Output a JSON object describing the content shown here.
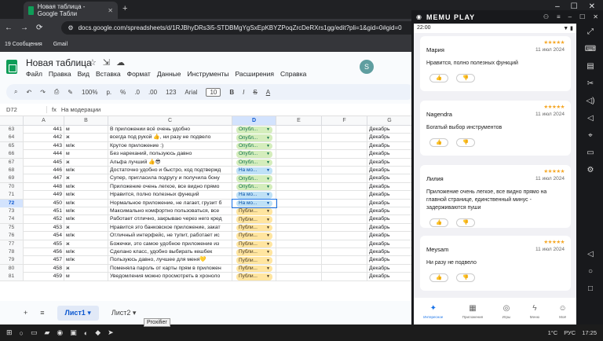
{
  "browser": {
    "tab_title": "Новая таблица - Google Табли",
    "url": "docs.google.com/spreadsheets/d/1RJBhyDRs3i5-STDBMgYgSxEpKBYZPoqZrcDeRXrs1gg/edit?pli=1&gid=0#gid=0",
    "bookmarks": [
      "19 Сообщения",
      "Gmail"
    ]
  },
  "sheets": {
    "title": "Новая таблица",
    "menu": [
      "Файл",
      "Правка",
      "Вид",
      "Вставка",
      "Формат",
      "Данные",
      "Инструменты",
      "Расширения",
      "Справка"
    ],
    "avatar": "S",
    "toolbar": {
      "zoom": "100%",
      "currency": "р.",
      "percent": "%",
      "dec": ".0",
      "dec2": ".00",
      "format123": "123",
      "font": "Arial",
      "font_size": "10"
    },
    "cell_ref": "D72",
    "formula": "На модерации",
    "columns": [
      "A",
      "B",
      "C",
      "D",
      "E",
      "F",
      "G"
    ],
    "rows": [
      {
        "n": "63",
        "a": "441",
        "b": "м",
        "c": "В приложении всё очень удобно",
        "d": "Опубл...",
        "s": "green",
        "g": "Декабрь"
      },
      {
        "n": "64",
        "a": "442",
        "b": "ж",
        "c": "всегда под рукой 👍, ни разу не подвело",
        "d": "Опубл...",
        "s": "green",
        "g": "Декабрь"
      },
      {
        "n": "65",
        "a": "443",
        "b": "м/ж",
        "c": "Крутое приложение :)",
        "d": "Опубл...",
        "s": "green",
        "g": "Декабрь"
      },
      {
        "n": "66",
        "a": "444",
        "b": "м",
        "c": " Без нареканий, пользуюсь давно",
        "d": "Опубл...",
        "s": "green",
        "g": "Декабрь"
      },
      {
        "n": "67",
        "a": "445",
        "b": "ж",
        "c": "Альфа лучший 👍😎",
        "d": "Опубл...",
        "s": "green",
        "g": "Декабрь"
      },
      {
        "n": "68",
        "a": "446",
        "b": "м/ж",
        "c": "Достаточно удобно и быстро, код подтвержд",
        "d": "На мо...",
        "s": "blue",
        "g": "Декабрь"
      },
      {
        "n": "69",
        "a": "447",
        "b": "ж",
        "c": "Супер, пригласила подругу и получила бону",
        "d": "Опубл...",
        "s": "green",
        "g": "Декабрь"
      },
      {
        "n": "70",
        "a": "448",
        "b": "м/ж",
        "c": "Приложение очень легкое, все видно прямо",
        "d": "Опубл...",
        "s": "green",
        "g": "Декабрь"
      },
      {
        "n": "71",
        "a": "449",
        "b": "м/ж",
        "c": "Нравится, полно полезных функций",
        "d": "На мо...",
        "s": "blue",
        "g": "Декабрь"
      },
      {
        "n": "72",
        "a": "450",
        "b": "м/ж",
        "c": "Нормальное приложение, не лагает, грузит б",
        "d": "На мо...",
        "s": "blue",
        "g": "Декабрь"
      },
      {
        "n": "73",
        "a": "451",
        "b": "м/ж",
        "c": "Максимально комфортно пользоваться, все",
        "d": "Публи...",
        "s": "orange",
        "g": "Декабрь"
      },
      {
        "n": "74",
        "a": "452",
        "b": "м/ж",
        "c": "Работает отлично, закрываю через него кред",
        "d": "Публи...",
        "s": "orange",
        "g": "Декабрь"
      },
      {
        "n": "75",
        "a": "453",
        "b": "ж",
        "c": "Нравится это банковское приложение, закат",
        "d": "Публи...",
        "s": "orange",
        "g": "Декабрь"
      },
      {
        "n": "76",
        "a": "454",
        "b": "м/ж",
        "c": "Отличный интерфейс, не тупит, работает ис",
        "d": "Публи...",
        "s": "orange",
        "g": "Декабрь"
      },
      {
        "n": "77",
        "a": "455",
        "b": "ж",
        "c": "Божечки, это самое удобное приложение из",
        "d": "Публи...",
        "s": "orange",
        "g": "Декабрь"
      },
      {
        "n": "78",
        "a": "456",
        "b": "м/ж",
        "c": "Сделано класс, удобно выбирать кешбек",
        "d": "Публи...",
        "s": "orange",
        "g": "Декабрь"
      },
      {
        "n": "79",
        "a": "457",
        "b": "м/ж",
        "c": "Пользуюсь давно, лучшее для меня💛",
        "d": "Публи...",
        "s": "orange",
        "g": "Декабрь"
      },
      {
        "n": "80",
        "a": "458",
        "b": "ж",
        "c": "Поменяла пароль от карты прям в приложен",
        "d": "Публи...",
        "s": "orange",
        "g": "Декабрь"
      },
      {
        "n": "81",
        "a": "459",
        "b": "м",
        "c": "Уведомления можно просмотреть в хроноло",
        "d": "Публи...",
        "s": "orange",
        "g": "Декабрь"
      }
    ],
    "sheet_tabs": [
      "Лист1",
      "Лист2"
    ],
    "tooltip": "Proxifier"
  },
  "memu": {
    "title": "MEMU PLAY",
    "time": "22:00",
    "reviews": [
      {
        "name": "Мария",
        "date": "11 июл 2024",
        "text": "Нравится, полно полезных функций"
      },
      {
        "name": "Nagendra",
        "date": "11 июл 2024",
        "text": "Богатый выбор инструментов"
      },
      {
        "name": "Лилия",
        "date": "11 июл 2024",
        "text": "Приложение очень легкое, все видно прямо на главной странице, единственный минус - задерживаются пуши"
      },
      {
        "name": "Meysam",
        "date": "11 июл 2024",
        "text": "Ни разу не подвело"
      }
    ],
    "nav": [
      "Интересное",
      "Приложения",
      "Игры",
      "Меню",
      "Моё"
    ]
  },
  "taskbar": {
    "lang": "РУС",
    "time": "17:25",
    "temp": "1°C"
  },
  "colors": {
    "accent": "#1a73e8",
    "green_chip": "#d4edbc",
    "blue_chip": "#bfe1f6",
    "orange_chip": "#ffe5a0"
  }
}
